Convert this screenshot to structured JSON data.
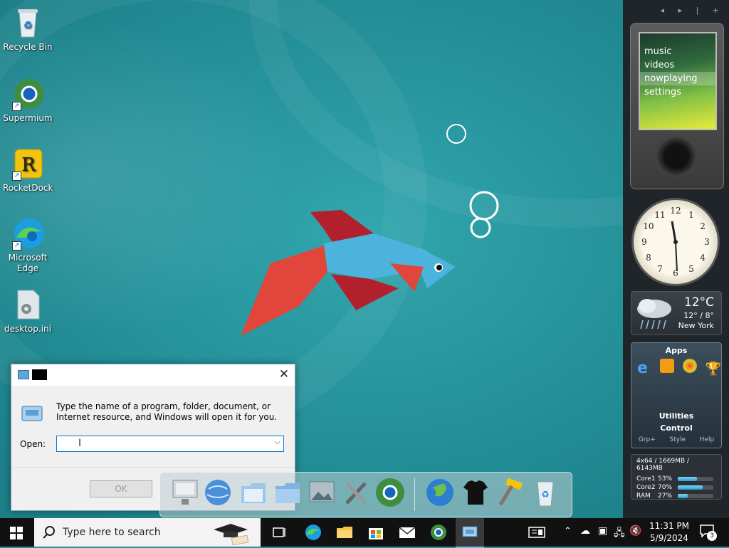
{
  "desktop": {
    "icons": [
      {
        "label": "Recycle Bin",
        "icon": "recycle-bin-icon"
      },
      {
        "label": "Supermium",
        "icon": "supermium-icon"
      },
      {
        "label": "RocketDock",
        "icon": "rocketdock-icon"
      },
      {
        "label": "Microsoft Edge",
        "icon": "edge-icon"
      },
      {
        "label": "desktop.ini",
        "icon": "settings-file-icon"
      }
    ]
  },
  "sidebar": {
    "zune_menu": [
      "music",
      "videos",
      "nowplaying",
      "settings"
    ],
    "zune_selected": "nowplaying",
    "clock_numbers": [
      "12",
      "1",
      "2",
      "3",
      "4",
      "5",
      "6",
      "7",
      "8",
      "9",
      "10",
      "11"
    ],
    "clock_time": "11:31",
    "weather": {
      "temp": "12°C",
      "range": "12° / 8°",
      "city": "New York"
    },
    "apps": {
      "title": "Apps",
      "utilities": "Utilities",
      "control": "Control",
      "footer": [
        "Grp+",
        "Style",
        "Help"
      ]
    },
    "sys": {
      "header": "4x64 / 1669MB / 6143MB",
      "rows": [
        {
          "label": "Core1",
          "value": "53%",
          "fill": 0.53
        },
        {
          "label": "Core2",
          "value": "70%",
          "fill": 0.7
        },
        {
          "label": "RAM",
          "value": "27%",
          "fill": 0.27
        }
      ]
    }
  },
  "run_dialog": {
    "description": "Type the name of a program, folder, document, or Internet resource, and Windows will open it for you.",
    "open_label": "Open:",
    "input_value": "",
    "ok_label": "OK"
  },
  "taskbar": {
    "search_placeholder": "Type here to search",
    "time": "11:31 PM",
    "date": "5/9/2024",
    "notification_count": "3"
  },
  "colors": {
    "taskbar": "#111111",
    "desktop": "#2a8f98",
    "accent": "#0078d7"
  }
}
